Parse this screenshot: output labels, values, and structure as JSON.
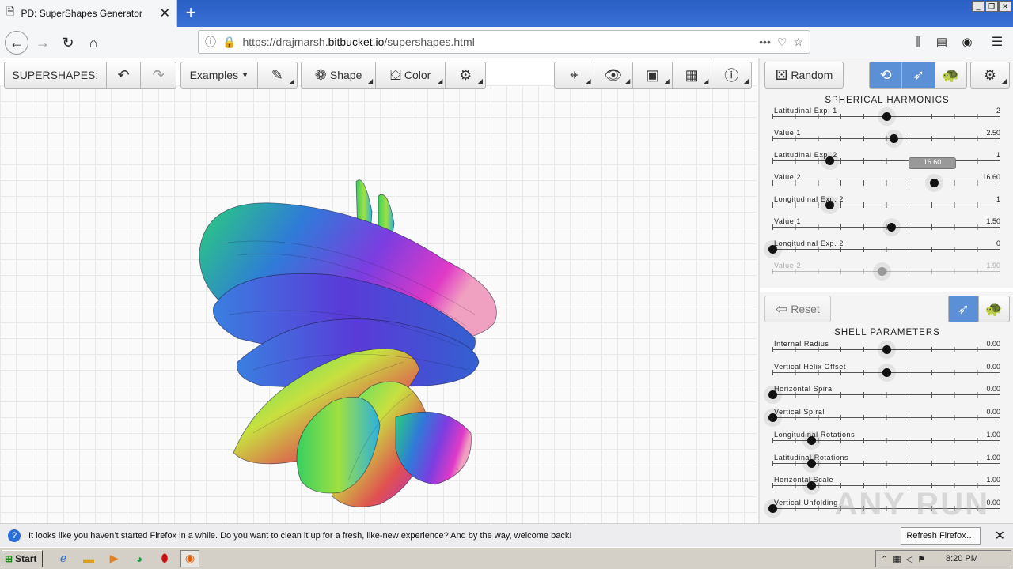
{
  "browser": {
    "tab_title": "PD: SuperShapes Generator",
    "url_prefix": "https://drajmarsh.",
    "url_domain": "bitbucket.io",
    "url_path": "/supershapes.html",
    "page_actions": "•••"
  },
  "toolbar": {
    "app_label": "SUPERSHAPES:",
    "examples_label": "Examples",
    "shape_label": "Shape",
    "color_label": "Color",
    "random_label": "Random",
    "reset_label": "Reset"
  },
  "harmonics": {
    "title": "SPHERICAL HARMONICS",
    "sliders": [
      {
        "label": "Latitudinal Exp. 1",
        "value": "2",
        "pos": 0.5
      },
      {
        "label": "Value 1",
        "value": "2.50",
        "pos": 0.53
      },
      {
        "label": "Latitudinal Exp. 2",
        "value": "1",
        "pos": 0.25
      },
      {
        "label": "Value 2",
        "value": "16.60",
        "pos": 0.71,
        "tooltip": "16.60"
      },
      {
        "label": "Longitudinal Exp. 2",
        "value": "1",
        "pos": 0.25
      },
      {
        "label": "Value 1",
        "value": "1.50",
        "pos": 0.52
      },
      {
        "label": "Longitudinal Exp. 2",
        "value": "0",
        "pos": 0.0
      },
      {
        "label": "Value 2",
        "value": "-1.90",
        "pos": 0.48,
        "disabled": true
      }
    ]
  },
  "shell": {
    "title": "SHELL PARAMETERS",
    "sliders": [
      {
        "label": "Internal Radius",
        "value": "0.00",
        "pos": 0.5
      },
      {
        "label": "Vertical Helix Offset",
        "value": "0.00",
        "pos": 0.5
      },
      {
        "label": "Horizontal Spiral",
        "value": "0.00",
        "pos": 0.0
      },
      {
        "label": "Vertical Spiral",
        "value": "0.00",
        "pos": 0.0
      },
      {
        "label": "Longitudinal Rotations",
        "value": "1.00",
        "pos": 0.17
      },
      {
        "label": "Latitudinal Rotations",
        "value": "1.00",
        "pos": 0.17
      },
      {
        "label": "Horizontal Scale",
        "value": "1.00",
        "pos": 0.17
      },
      {
        "label": "Vertical Unfolding",
        "value": "0.00",
        "pos": 0.0
      }
    ]
  },
  "notification": {
    "message": "It looks like you haven’t started Firefox in a while. Do you want to clean it up for a fresh, like-new experience? And by the way, welcome back!",
    "button": "Refresh Firefox…"
  },
  "taskbar": {
    "start": "Start",
    "time": "8:20 PM"
  },
  "watermark": "ANY RUN"
}
